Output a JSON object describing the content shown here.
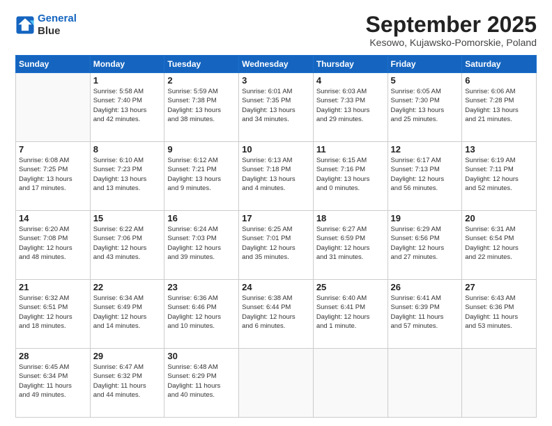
{
  "header": {
    "logo_line1": "General",
    "logo_line2": "Blue",
    "month": "September 2025",
    "location": "Kesowo, Kujawsko-Pomorskie, Poland"
  },
  "days_of_week": [
    "Sunday",
    "Monday",
    "Tuesday",
    "Wednesday",
    "Thursday",
    "Friday",
    "Saturday"
  ],
  "weeks": [
    [
      {
        "day": "",
        "info": ""
      },
      {
        "day": "1",
        "info": "Sunrise: 5:58 AM\nSunset: 7:40 PM\nDaylight: 13 hours\nand 42 minutes."
      },
      {
        "day": "2",
        "info": "Sunrise: 5:59 AM\nSunset: 7:38 PM\nDaylight: 13 hours\nand 38 minutes."
      },
      {
        "day": "3",
        "info": "Sunrise: 6:01 AM\nSunset: 7:35 PM\nDaylight: 13 hours\nand 34 minutes."
      },
      {
        "day": "4",
        "info": "Sunrise: 6:03 AM\nSunset: 7:33 PM\nDaylight: 13 hours\nand 29 minutes."
      },
      {
        "day": "5",
        "info": "Sunrise: 6:05 AM\nSunset: 7:30 PM\nDaylight: 13 hours\nand 25 minutes."
      },
      {
        "day": "6",
        "info": "Sunrise: 6:06 AM\nSunset: 7:28 PM\nDaylight: 13 hours\nand 21 minutes."
      }
    ],
    [
      {
        "day": "7",
        "info": "Sunrise: 6:08 AM\nSunset: 7:25 PM\nDaylight: 13 hours\nand 17 minutes."
      },
      {
        "day": "8",
        "info": "Sunrise: 6:10 AM\nSunset: 7:23 PM\nDaylight: 13 hours\nand 13 minutes."
      },
      {
        "day": "9",
        "info": "Sunrise: 6:12 AM\nSunset: 7:21 PM\nDaylight: 13 hours\nand 9 minutes."
      },
      {
        "day": "10",
        "info": "Sunrise: 6:13 AM\nSunset: 7:18 PM\nDaylight: 13 hours\nand 4 minutes."
      },
      {
        "day": "11",
        "info": "Sunrise: 6:15 AM\nSunset: 7:16 PM\nDaylight: 13 hours\nand 0 minutes."
      },
      {
        "day": "12",
        "info": "Sunrise: 6:17 AM\nSunset: 7:13 PM\nDaylight: 12 hours\nand 56 minutes."
      },
      {
        "day": "13",
        "info": "Sunrise: 6:19 AM\nSunset: 7:11 PM\nDaylight: 12 hours\nand 52 minutes."
      }
    ],
    [
      {
        "day": "14",
        "info": "Sunrise: 6:20 AM\nSunset: 7:08 PM\nDaylight: 12 hours\nand 48 minutes."
      },
      {
        "day": "15",
        "info": "Sunrise: 6:22 AM\nSunset: 7:06 PM\nDaylight: 12 hours\nand 43 minutes."
      },
      {
        "day": "16",
        "info": "Sunrise: 6:24 AM\nSunset: 7:03 PM\nDaylight: 12 hours\nand 39 minutes."
      },
      {
        "day": "17",
        "info": "Sunrise: 6:25 AM\nSunset: 7:01 PM\nDaylight: 12 hours\nand 35 minutes."
      },
      {
        "day": "18",
        "info": "Sunrise: 6:27 AM\nSunset: 6:59 PM\nDaylight: 12 hours\nand 31 minutes."
      },
      {
        "day": "19",
        "info": "Sunrise: 6:29 AM\nSunset: 6:56 PM\nDaylight: 12 hours\nand 27 minutes."
      },
      {
        "day": "20",
        "info": "Sunrise: 6:31 AM\nSunset: 6:54 PM\nDaylight: 12 hours\nand 22 minutes."
      }
    ],
    [
      {
        "day": "21",
        "info": "Sunrise: 6:32 AM\nSunset: 6:51 PM\nDaylight: 12 hours\nand 18 minutes."
      },
      {
        "day": "22",
        "info": "Sunrise: 6:34 AM\nSunset: 6:49 PM\nDaylight: 12 hours\nand 14 minutes."
      },
      {
        "day": "23",
        "info": "Sunrise: 6:36 AM\nSunset: 6:46 PM\nDaylight: 12 hours\nand 10 minutes."
      },
      {
        "day": "24",
        "info": "Sunrise: 6:38 AM\nSunset: 6:44 PM\nDaylight: 12 hours\nand 6 minutes."
      },
      {
        "day": "25",
        "info": "Sunrise: 6:40 AM\nSunset: 6:41 PM\nDaylight: 12 hours\nand 1 minute."
      },
      {
        "day": "26",
        "info": "Sunrise: 6:41 AM\nSunset: 6:39 PM\nDaylight: 11 hours\nand 57 minutes."
      },
      {
        "day": "27",
        "info": "Sunrise: 6:43 AM\nSunset: 6:36 PM\nDaylight: 11 hours\nand 53 minutes."
      }
    ],
    [
      {
        "day": "28",
        "info": "Sunrise: 6:45 AM\nSunset: 6:34 PM\nDaylight: 11 hours\nand 49 minutes."
      },
      {
        "day": "29",
        "info": "Sunrise: 6:47 AM\nSunset: 6:32 PM\nDaylight: 11 hours\nand 44 minutes."
      },
      {
        "day": "30",
        "info": "Sunrise: 6:48 AM\nSunset: 6:29 PM\nDaylight: 11 hours\nand 40 minutes."
      },
      {
        "day": "",
        "info": ""
      },
      {
        "day": "",
        "info": ""
      },
      {
        "day": "",
        "info": ""
      },
      {
        "day": "",
        "info": ""
      }
    ]
  ]
}
